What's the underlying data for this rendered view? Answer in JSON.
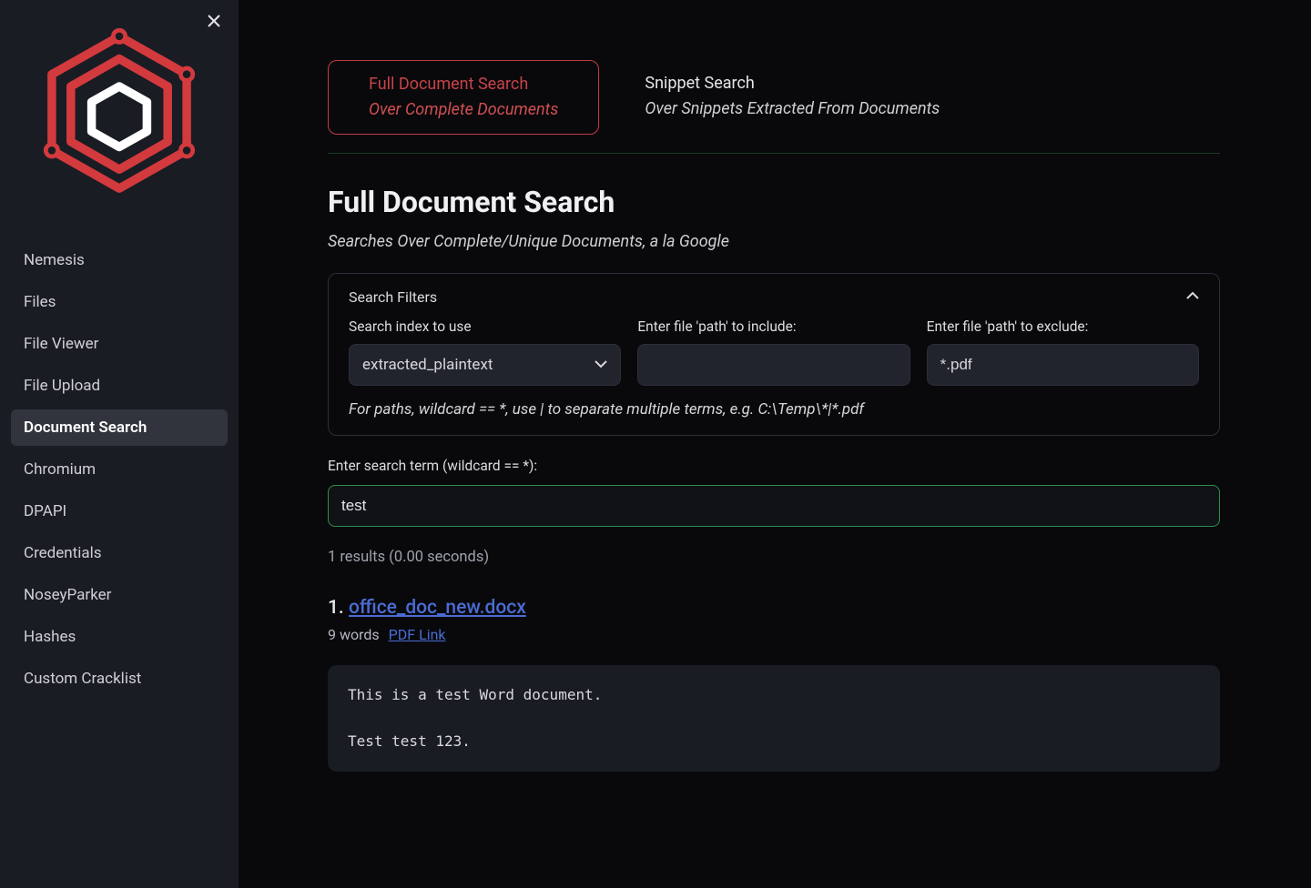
{
  "sidebar": {
    "items": [
      {
        "label": "Nemesis",
        "name": "sidebar-item-nemesis",
        "active": false
      },
      {
        "label": "Files",
        "name": "sidebar-item-files",
        "active": false
      },
      {
        "label": "File Viewer",
        "name": "sidebar-item-file-viewer",
        "active": false
      },
      {
        "label": "File Upload",
        "name": "sidebar-item-file-upload",
        "active": false
      },
      {
        "label": "Document Search",
        "name": "sidebar-item-document-search",
        "active": true
      },
      {
        "label": "Chromium",
        "name": "sidebar-item-chromium",
        "active": false
      },
      {
        "label": "DPAPI",
        "name": "sidebar-item-dpapi",
        "active": false
      },
      {
        "label": "Credentials",
        "name": "sidebar-item-credentials",
        "active": false
      },
      {
        "label": "NoseyParker",
        "name": "sidebar-item-noseyparker",
        "active": false
      },
      {
        "label": "Hashes",
        "name": "sidebar-item-hashes",
        "active": false
      },
      {
        "label": "Custom Cracklist",
        "name": "sidebar-item-custom-cracklist",
        "active": false
      }
    ]
  },
  "tabs": [
    {
      "title": "Full Document Search",
      "sub": "Over Complete Documents",
      "active": true,
      "name": "tab-full-document-search"
    },
    {
      "title": "Snippet Search",
      "sub": "Over Snippets Extracted From Documents",
      "active": false,
      "name": "tab-snippet-search"
    }
  ],
  "page": {
    "heading": "Full Document Search",
    "subheading": "Searches Over Complete/Unique Documents, a la Google"
  },
  "filters": {
    "header": "Search Filters",
    "index_label": "Search index to use",
    "index_value": "extracted_plaintext",
    "include_label": "Enter file 'path' to include:",
    "include_value": "",
    "exclude_label": "Enter file 'path' to exclude:",
    "exclude_value": "*.pdf",
    "hint": "For paths, wildcard == *, use | to separate multiple terms, e.g. C:\\Temp\\*|*.pdf"
  },
  "search": {
    "term_label": "Enter search term (wildcard == *):",
    "term_value": "test"
  },
  "results": {
    "meta": "1 results (0.00 seconds)",
    "items": [
      {
        "num": "1. ",
        "title": "office_doc_new.docx",
        "words": "9 words",
        "pdf_link_label": "PDF Link",
        "snippet": "This is a test Word document.\n\nTest test 123."
      }
    ]
  }
}
